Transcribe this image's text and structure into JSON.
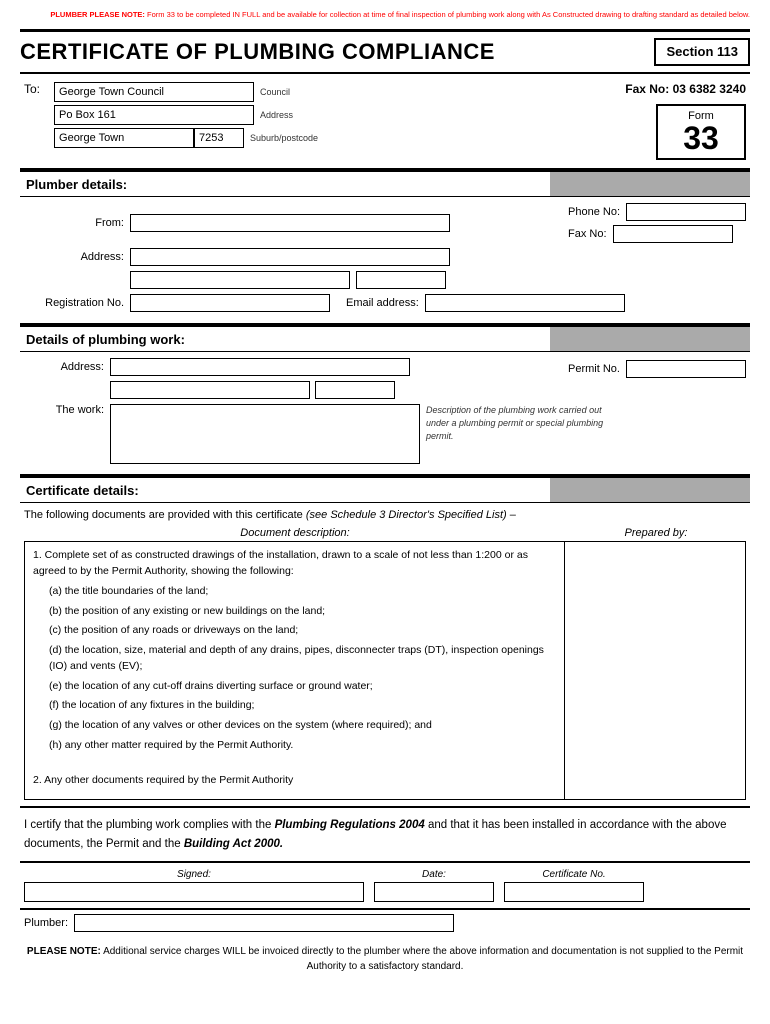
{
  "top_notice": {
    "label": "PLUMBER PLEASE NOTE:",
    "text": "Form 33 to be completed IN FULL and be available for collection at time of final inspection of plumbing work along with As Constructed drawing to drafting standard as detailed below."
  },
  "header": {
    "title": "CERTIFICATE OF PLUMBING COMPLIANCE",
    "section_label": "Section 113"
  },
  "to": {
    "label": "To:",
    "council_value": "George Town Council",
    "council_label": "Council",
    "address_value": "Po Box 161",
    "address_label": "Address",
    "suburb_value": "George Town",
    "postcode_value": "7253",
    "suburb_label": "Suburb/postcode",
    "fax": "Fax No: 03 6382 3240",
    "form_word": "Form",
    "form_num": "33"
  },
  "plumber_details": {
    "section_title": "Plumber details:",
    "from_label": "From:",
    "address_label": "Address:",
    "phone_label": "Phone No:",
    "fax_label": "Fax No:",
    "reg_label": "Registration No.",
    "email_label": "Email address:"
  },
  "plumbing_work": {
    "section_title": "Details of plumbing work:",
    "address_label": "Address:",
    "permit_label": "Permit No.",
    "work_label": "The work:",
    "work_desc": "Description of the plumbing work carried out under a plumbing permit or special plumbing permit."
  },
  "cert_details": {
    "section_title": "Certificate details:",
    "intro": "The following documents are provided with this certificate",
    "intro_note": "(see Schedule 3 Director's Specified List)",
    "intro_dash": "–",
    "col_doc": "Document description:",
    "col_prepared": "Prepared by:",
    "doc_items": [
      "1. Complete set of as constructed drawings of the installation, drawn to a scale of  not less than 1:200 or as agreed to by the Permit Authority, showing the following:",
      "(a) the title boundaries of the land;",
      "(b) the position of any existing or new buildings on the land;",
      "(c) the position of any roads or driveways on the land;",
      "(d) the location, size, material and depth of any drains, pipes, disconnecter traps (DT), inspection openings (IO) and vents (EV);",
      "(e) the location of any cut-off drains diverting surface or ground water;",
      "(f) the location of any fixtures in the building;",
      "(g) the location of any valves or other devices on the system (where required); and",
      "(h) any other matter required by the Permit Authority.",
      "",
      "2. Any other documents required by the Permit Authority"
    ]
  },
  "certify": {
    "text1": "I certify that the plumbing work complies with the",
    "text2": "Plumbing Regulations 2004",
    "text3": "and that it has been installed in accordance with the above documents, the Permit and the",
    "text4": "Building Act 2000."
  },
  "sign": {
    "signed_label": "Signed:",
    "date_label": "Date:",
    "cert_label": "Certificate No.",
    "plumber_label": "Plumber:"
  },
  "bottom_note": {
    "label": "PLEASE NOTE:",
    "text": "Additional service charges WILL be invoiced directly to the plumber where the above information and documentation is not supplied to the Permit Authority to a satisfactory standard."
  }
}
